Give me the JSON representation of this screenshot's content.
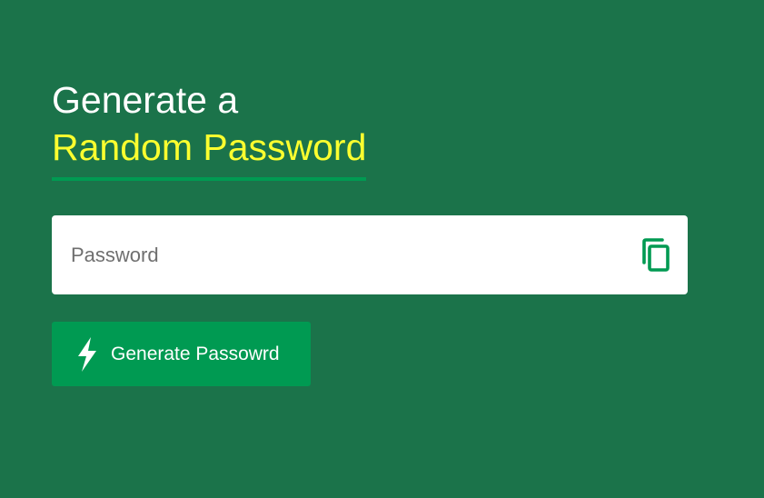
{
  "header": {
    "title_line1": "Generate a",
    "title_line2": "Random Password"
  },
  "password_field": {
    "placeholder": "Password",
    "value": ""
  },
  "copy_button": {
    "icon": "copy-icon"
  },
  "generate_button": {
    "label": "Generate Passowrd",
    "icon": "lightning-bolt-icon"
  },
  "colors": {
    "background": "#1b734a",
    "accent_green": "#009a52",
    "highlight_yellow": "#fbff2f",
    "white": "#ffffff"
  }
}
